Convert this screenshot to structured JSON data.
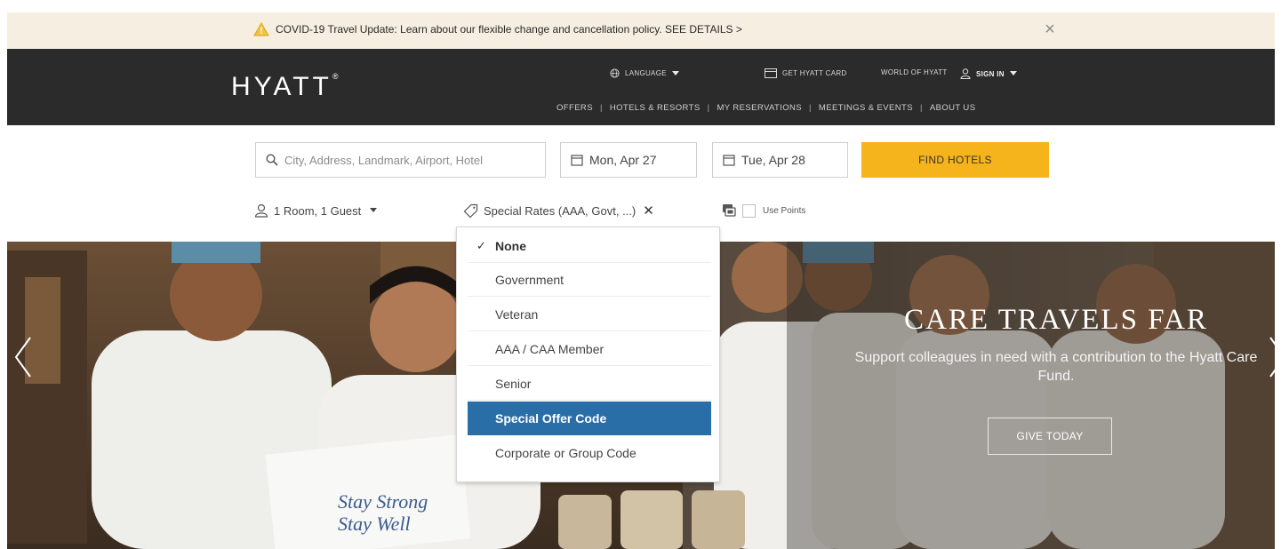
{
  "alert": {
    "text": "COVID-19 Travel Update: Learn about our flexible change and cancellation policy. SEE DETAILS >",
    "close": "×"
  },
  "header": {
    "logo": "HYATT",
    "utility": {
      "language": "LANGUAGE",
      "hyatt_card": "GET HYATT CARD",
      "world_of_hyatt": "WORLD OF HYATT",
      "sign_in": "SIGN IN"
    },
    "nav": [
      "OFFERS",
      "HOTELS & RESORTS",
      "MY RESERVATIONS",
      "MEETINGS & EVENTS",
      "ABOUT US"
    ],
    "nav_separator": "|"
  },
  "search": {
    "placeholder": "City, Address, Landmark, Airport, Hotel",
    "checkin": "Mon, Apr 27",
    "checkout": "Tue, Apr 28",
    "find_button": "FIND HOTELS",
    "rooms_guests": "1 Room, 1 Guest",
    "special_rates": "Special Rates (AAA, Govt, ...)",
    "special_rates_clear": "✕",
    "use_points": "Use Points"
  },
  "special_rates_menu": {
    "items": [
      {
        "label": "None",
        "selected": true
      },
      {
        "label": "Government"
      },
      {
        "label": "Veteran"
      },
      {
        "label": "AAA / CAA Member"
      },
      {
        "label": "Senior"
      },
      {
        "label": "Special Offer Code",
        "highlighted": true
      },
      {
        "label": "Corporate or Group Code"
      }
    ],
    "check": "✓"
  },
  "hero": {
    "title": "CARE TRAVELS FAR",
    "subtitle": "Support colleagues in need with a contribution to the Hyatt Care Fund.",
    "button": "GIVE TODAY"
  },
  "colors": {
    "accent": "#f5b31c",
    "header_bg": "#2b2b2b",
    "alert_bg": "#f6efe1",
    "highlight": "#2a6ea8"
  }
}
